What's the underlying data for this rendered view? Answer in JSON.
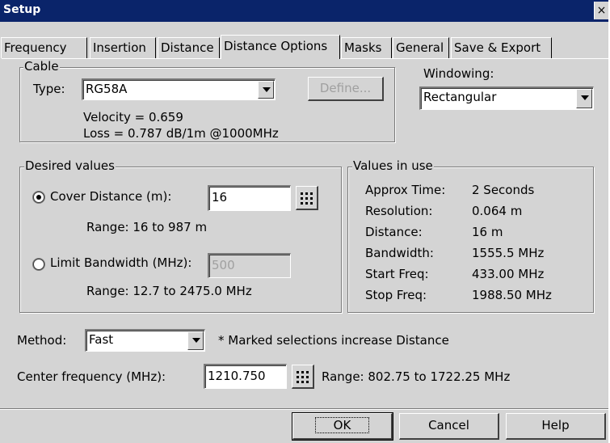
{
  "window": {
    "title": "Setup",
    "close_label": "×"
  },
  "tabs": [
    {
      "label": "Frequency"
    },
    {
      "label": "Insertion"
    },
    {
      "label": "Distance"
    },
    {
      "label": "Distance Options"
    },
    {
      "label": "Masks"
    },
    {
      "label": "General"
    },
    {
      "label": "Save & Export"
    }
  ],
  "active_tab": "Distance Options",
  "cable": {
    "group_label": "Cable",
    "type_label": "Type:",
    "type_value": "RG58A",
    "define_label": "Define...",
    "velocity": "Velocity = 0.659",
    "loss": "Loss = 0.787 dB/1m @1000MHz"
  },
  "windowing": {
    "label": "Windowing:",
    "value": "Rectangular"
  },
  "desired": {
    "group_label": "Desired values",
    "cover_label": "Cover Distance (m):",
    "cover_value": "16",
    "cover_range": "Range: 16 to 987 m",
    "limit_label": "Limit Bandwidth (MHz):",
    "limit_value": "500",
    "limit_range": "Range: 12.7 to 2475.0 MHz",
    "selected": "cover"
  },
  "in_use": {
    "group_label": "Values in use",
    "rows": [
      {
        "label": "Approx Time:",
        "value": "2 Seconds"
      },
      {
        "label": "Resolution:",
        "value": "0.064 m"
      },
      {
        "label": "Distance:",
        "value": "16 m"
      },
      {
        "label": "Bandwidth:",
        "value": "1555.5 MHz"
      },
      {
        "label": "Start Freq:",
        "value": "433.00 MHz"
      },
      {
        "label": "Stop Freq:",
        "value": "1988.50 MHz"
      }
    ]
  },
  "method": {
    "label": "Method:",
    "value": "Fast",
    "note": "* Marked selections increase Distance"
  },
  "center": {
    "label": "Center frequency (MHz):",
    "value": "1210.750",
    "range": "Range: 802.75 to 1722.25 MHz"
  },
  "buttons": {
    "ok": "OK",
    "cancel": "Cancel",
    "help": "Help"
  },
  "colors": {
    "titlebar": "#0a246a",
    "face": "#d4d4d4"
  }
}
